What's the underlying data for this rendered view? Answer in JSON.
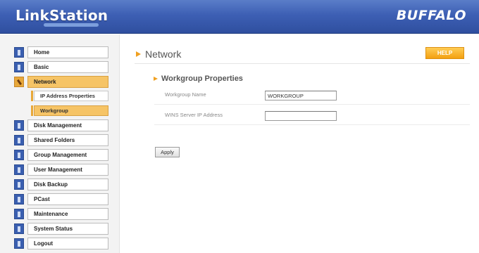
{
  "header": {
    "logo": "LinkStation",
    "brand": "BUFFALO"
  },
  "sidebar": {
    "items": [
      {
        "label": "Home",
        "icon": "home-icon"
      },
      {
        "label": "Basic",
        "icon": "basic-icon"
      },
      {
        "label": "Network",
        "icon": "network-icon",
        "active": true
      },
      {
        "label": "Disk Management",
        "icon": "disk-icon"
      },
      {
        "label": "Shared Folders",
        "icon": "folder-icon"
      },
      {
        "label": "Group Management",
        "icon": "group-icon"
      },
      {
        "label": "User Management",
        "icon": "user-icon"
      },
      {
        "label": "Disk Backup",
        "icon": "backup-icon"
      },
      {
        "label": "PCast",
        "icon": "pcast-icon"
      },
      {
        "label": "Maintenance",
        "icon": "maintenance-icon"
      },
      {
        "label": "System Status",
        "icon": "status-icon"
      },
      {
        "label": "Logout",
        "icon": "logout-icon"
      }
    ],
    "sub_items": [
      {
        "label": "IP Address Properties"
      },
      {
        "label": "Workgroup",
        "active": true
      }
    ]
  },
  "main": {
    "title": "Network",
    "help_label": "HELP",
    "section_title": "Workgroup Properties",
    "fields": [
      {
        "label": "Workgroup Name",
        "value": "WORKGROUP"
      },
      {
        "label": "WINS Server IP Address",
        "value": ""
      }
    ],
    "apply_label": "Apply"
  },
  "colors": {
    "header_blue": "#3d5fb4",
    "accent_orange": "#f3a010",
    "active_item": "#f6c466"
  }
}
